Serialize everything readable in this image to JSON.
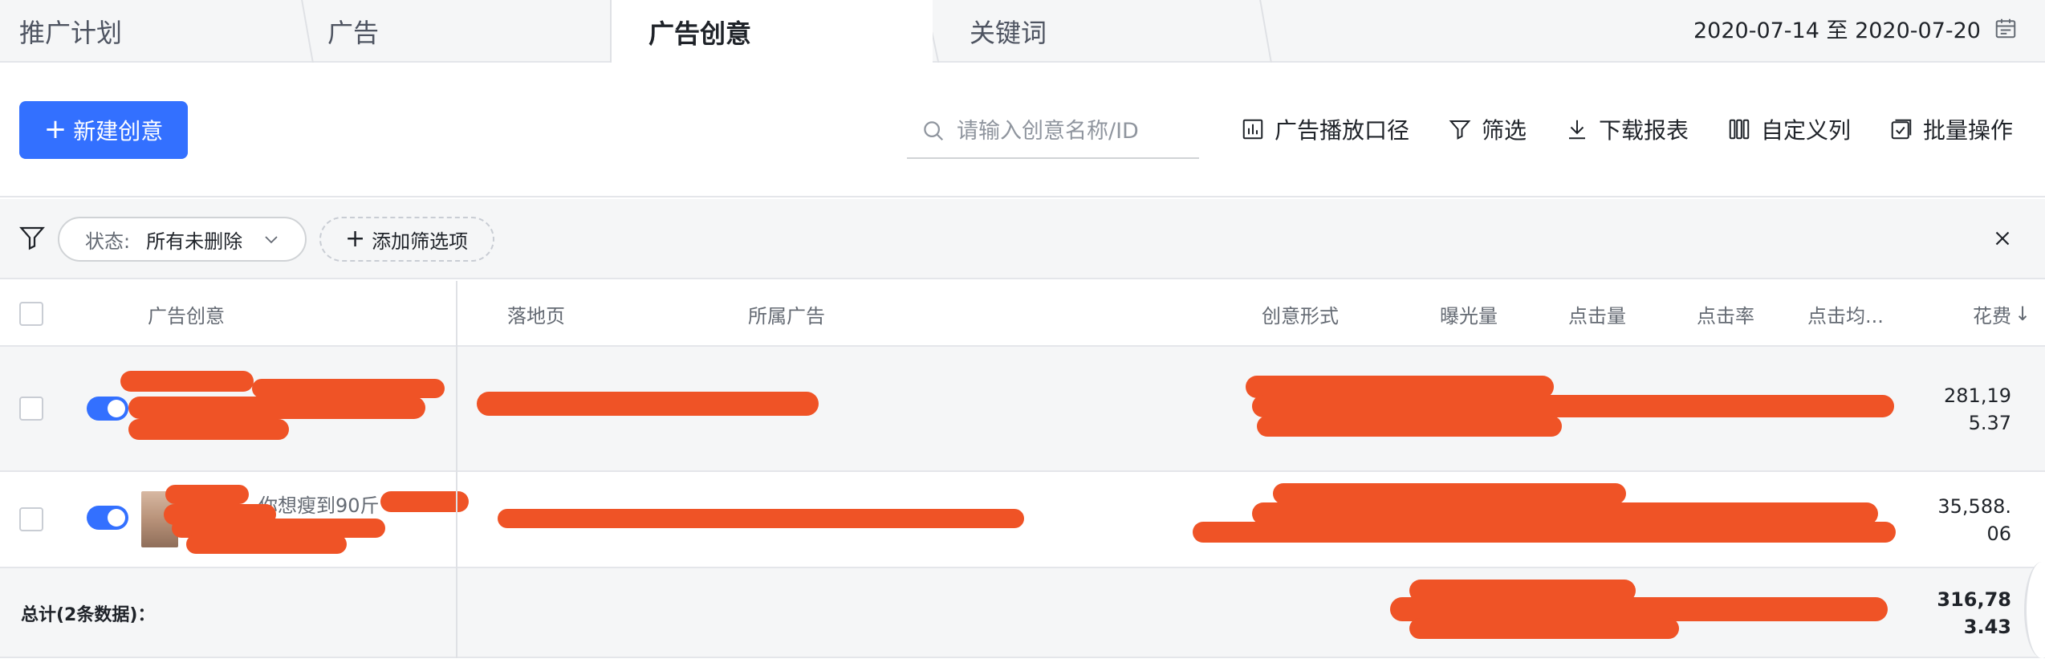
{
  "tabs": [
    {
      "label": "推广计划"
    },
    {
      "label": "广告"
    },
    {
      "label": "广告创意"
    },
    {
      "label": "关键词"
    }
  ],
  "active_tab": "广告创意",
  "date_range": "2020-07-14 至 2020-07-20",
  "toolbar": {
    "new_button": "新建创意",
    "search_placeholder": "请输入创意名称/ID",
    "actions": [
      "广告播放口径",
      "筛选",
      "下载报表",
      "自定义列",
      "批量操作"
    ]
  },
  "filters": {
    "status_key": "状态:",
    "status_value": "所有未删除",
    "add_filter": "添加筛选项"
  },
  "table": {
    "columns": [
      "广告创意",
      "落地页",
      "所属广告",
      "创意形式",
      "曝光量",
      "点击量",
      "点击率",
      "点击均...",
      "花费"
    ],
    "sort_indicator": "↓",
    "rows": [
      {
        "toggle_on": true,
        "creative_text": "",
        "spend_line1": "281,19",
        "spend_line2": "5.37"
      },
      {
        "toggle_on": true,
        "creative_text": "你想瘦到90斤",
        "spend_line1": "35,588.",
        "spend_line2": "06"
      }
    ],
    "total_label": "总计(2条数据)：",
    "total_spend_line1": "316,78",
    "total_spend_line2": "3.43"
  },
  "colors": {
    "accent": "#3370ff",
    "redaction": "#ef5326",
    "background_gray": "#f5f6f7"
  }
}
